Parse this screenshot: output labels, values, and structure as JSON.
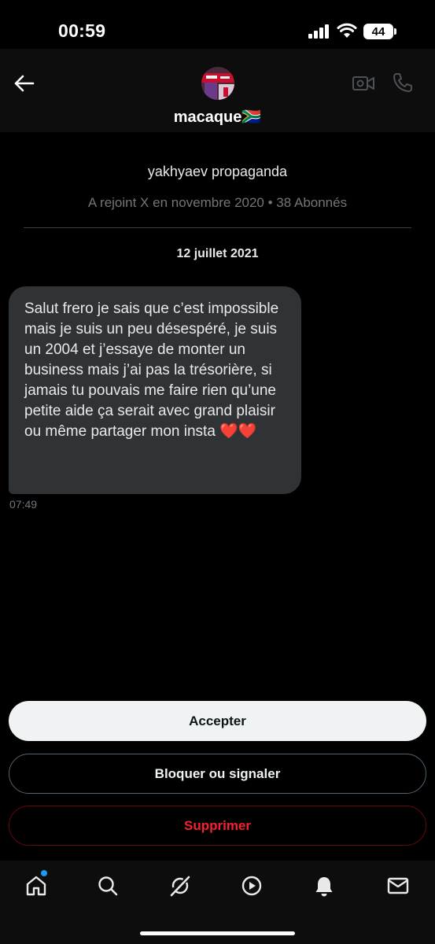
{
  "status_bar": {
    "time": "00:59",
    "battery": "44"
  },
  "header": {
    "name": "macaque🇿🇦"
  },
  "profile": {
    "handle": "yakhyaev propaganda",
    "meta": "A rejoint X en novembre 2020 • 38 Abonnés"
  },
  "conversation": {
    "date": "12 juillet 2021",
    "message": "Salut frero je sais que c’est impossible mais je suis un peu désespéré, je suis un 2004 et j’essaye de monter un business mais j’ai pas la trésorière, si jamais tu pouvais me faire rien qu’une petite aide ça serait avec grand plaisir ou même partager mon insta ❤️❤️",
    "time": "07:49"
  },
  "actions": {
    "accept": "Accepter",
    "block": "Bloquer ou signaler",
    "delete": "Supprimer"
  },
  "nav": {
    "items": [
      "home-icon",
      "search-icon",
      "grok-icon",
      "play-icon",
      "bell-icon",
      "mail-icon"
    ],
    "notification_color": "#1d9bf0"
  },
  "colors": {
    "background": "#000000",
    "bubble": "#2f3336",
    "danger": "#f4212e",
    "muted": "#71767b"
  }
}
